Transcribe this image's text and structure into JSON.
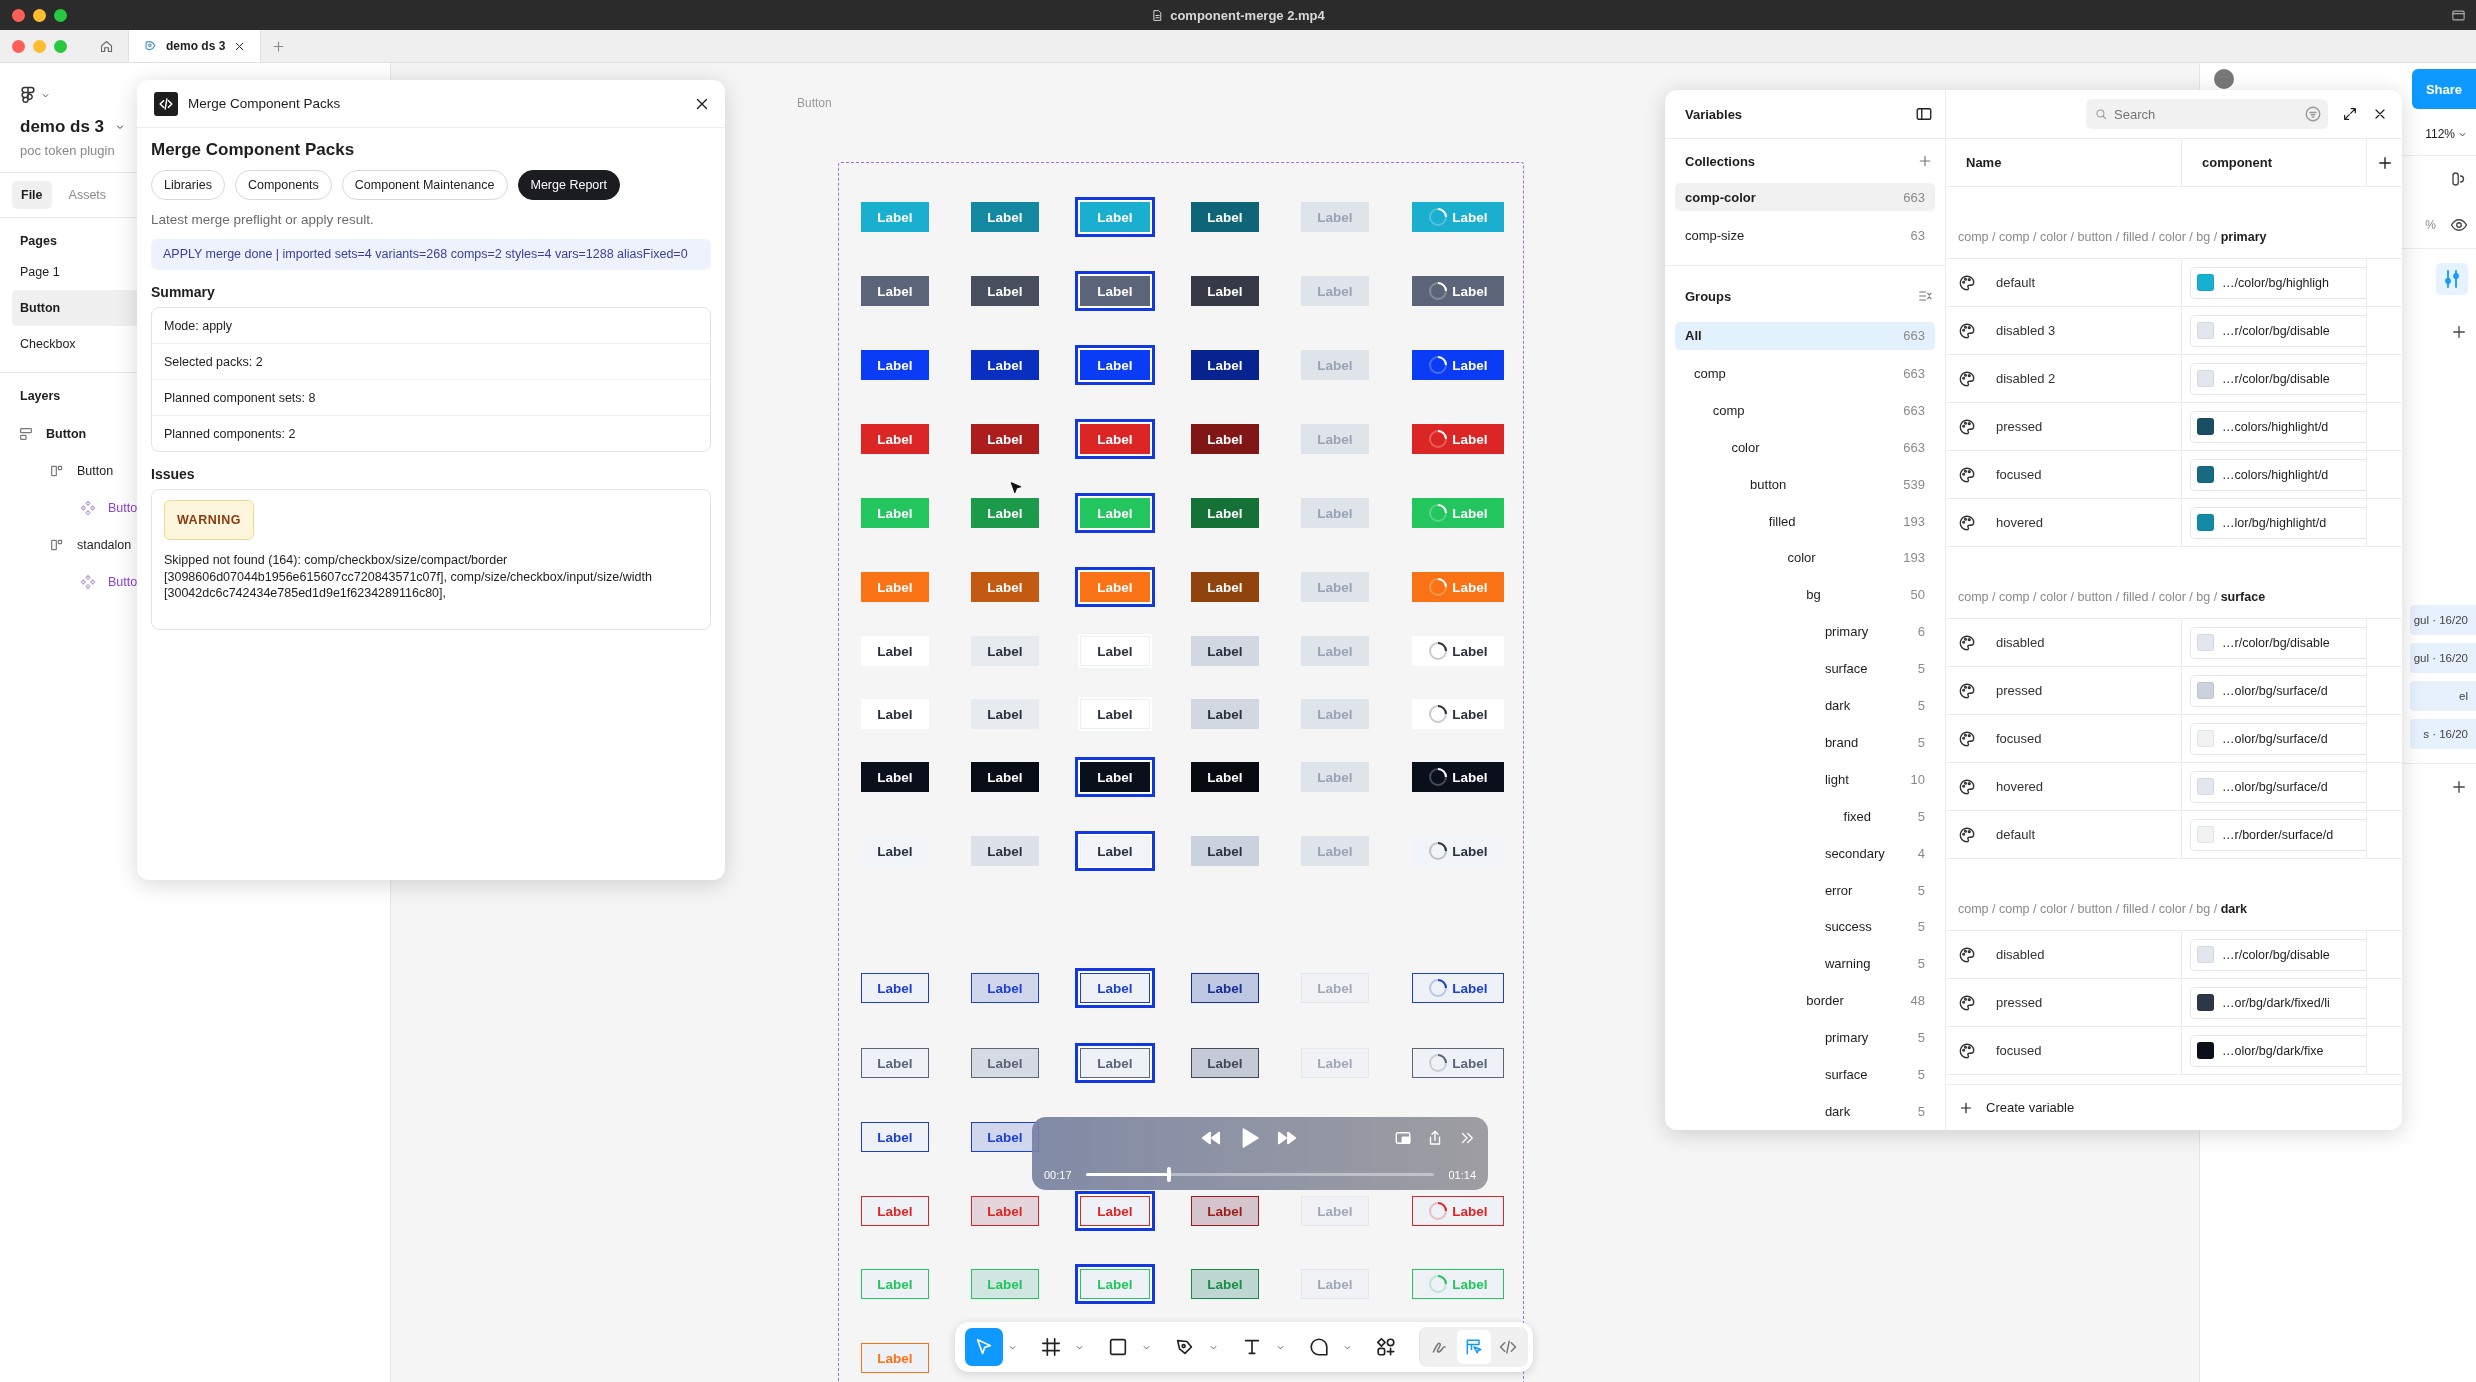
{
  "titlebar": {
    "title": "component-merge 2.mp4"
  },
  "tabbar": {
    "tabs": [
      {
        "label": "demo ds 3",
        "selected": true
      }
    ]
  },
  "sidebar": {
    "file_name": "demo ds 3",
    "subtitle": "poc token plugin",
    "tabs": [
      {
        "label": "File",
        "selected": true
      },
      {
        "label": "Assets",
        "selected": false
      }
    ],
    "pages_title": "Pages",
    "pages": [
      {
        "label": "Page 1",
        "selected": false
      },
      {
        "label": "Button",
        "selected": true
      },
      {
        "label": "Checkbox",
        "selected": false
      }
    ],
    "layers_title": "Layers",
    "layers": [
      {
        "label": "Button",
        "kind": "frame",
        "children": [
          {
            "label": "Button",
            "kind": "set",
            "children": [
              {
                "label": "Butto",
                "kind": "component"
              }
            ]
          },
          {
            "label": "standalon",
            "kind": "set",
            "children": [
              {
                "label": "Butto",
                "kind": "component"
              }
            ]
          }
        ]
      }
    ]
  },
  "canvas": {
    "frame_label": "Button",
    "rows": [
      {
        "kind": "filled",
        "color": "#1aaecf",
        "cells": [
          {
            "kind": "default",
            "label": "Label"
          },
          {
            "kind": "hover",
            "label": "Label"
          },
          {
            "kind": "focused",
            "label": "Label"
          },
          {
            "kind": "pressed",
            "label": "Label"
          },
          {
            "kind": "disabled",
            "label": "Label"
          },
          {
            "kind": "loading",
            "label": "Label"
          }
        ]
      },
      {
        "kind": "filled",
        "color": "#5b6478",
        "cells": [
          {
            "kind": "default",
            "label": "Label"
          },
          {
            "kind": "hover",
            "label": "Label"
          },
          {
            "kind": "focused",
            "label": "Label"
          },
          {
            "kind": "pressed",
            "label": "Label"
          },
          {
            "kind": "disabled",
            "label": "Label"
          },
          {
            "kind": "loading",
            "label": "Label"
          }
        ]
      },
      {
        "kind": "filled",
        "color": "#0a3cf5",
        "cells": [
          {
            "kind": "default",
            "label": "Label"
          },
          {
            "kind": "hover",
            "label": "Label"
          },
          {
            "kind": "focused",
            "label": "Label"
          },
          {
            "kind": "pressed",
            "label": "Label"
          },
          {
            "kind": "disabled",
            "label": "Label"
          },
          {
            "kind": "loading",
            "label": "Label"
          }
        ]
      },
      {
        "kind": "filled",
        "color": "#dc2626",
        "cells": [
          {
            "kind": "default",
            "label": "Label"
          },
          {
            "kind": "hover",
            "label": "Label"
          },
          {
            "kind": "focused",
            "label": "Label"
          },
          {
            "kind": "pressed",
            "label": "Label"
          },
          {
            "kind": "disabled",
            "label": "Label"
          },
          {
            "kind": "loading",
            "label": "Label"
          }
        ]
      },
      {
        "kind": "filled",
        "color": "#22c55e",
        "cells": [
          {
            "kind": "default",
            "label": "Label"
          },
          {
            "kind": "hover",
            "label": "Label"
          },
          {
            "kind": "focused",
            "label": "Label"
          },
          {
            "kind": "pressed",
            "label": "Label"
          },
          {
            "kind": "disabled",
            "label": "Label"
          },
          {
            "kind": "loading",
            "label": "Label"
          }
        ]
      },
      {
        "kind": "filled",
        "color": "#f97316",
        "cells": [
          {
            "kind": "default",
            "label": "Label"
          },
          {
            "kind": "hover",
            "label": "Label"
          },
          {
            "kind": "focused",
            "label": "Label"
          },
          {
            "kind": "pressed",
            "label": "Label"
          },
          {
            "kind": "disabled",
            "label": "Label"
          },
          {
            "kind": "loading",
            "label": "Label"
          }
        ]
      },
      {
        "kind": "filled",
        "color": "#ffffff",
        "cells": [
          {
            "kind": "default",
            "label": "Label"
          },
          {
            "kind": "hover",
            "label": "Label"
          },
          {
            "kind": "focused",
            "label": "Label"
          },
          {
            "kind": "pressed",
            "label": "Label"
          },
          {
            "kind": "disabled",
            "label": "Label"
          },
          {
            "kind": "loading",
            "label": "Label"
          }
        ]
      },
      {
        "kind": "filled",
        "color": "#ffffff",
        "cells": [
          {
            "kind": "default",
            "label": "Label"
          },
          {
            "kind": "hover",
            "label": "Label"
          },
          {
            "kind": "focused",
            "label": "Label"
          },
          {
            "kind": "pressed",
            "label": "Label"
          },
          {
            "kind": "disabled",
            "label": "Label"
          },
          {
            "kind": "loading",
            "label": "Label"
          }
        ]
      },
      {
        "kind": "filled",
        "color": "#0a0f1c",
        "cells": [
          {
            "kind": "default",
            "label": "Label"
          },
          {
            "kind": "hover",
            "label": "Label"
          },
          {
            "kind": "focused",
            "label": "Label"
          },
          {
            "kind": "pressed",
            "label": "Label"
          },
          {
            "kind": "disabled",
            "label": "Label"
          },
          {
            "kind": "loading",
            "label": "Label"
          }
        ]
      },
      {
        "kind": "filled",
        "color": "#f1f4f8",
        "cells": [
          {
            "kind": "default",
            "label": "Label"
          },
          {
            "kind": "hover",
            "label": "Label"
          },
          {
            "kind": "focused",
            "label": "Label"
          },
          {
            "kind": "pressed",
            "label": "Label"
          },
          {
            "kind": "disabled",
            "label": "Label"
          },
          {
            "kind": "loading",
            "label": "Label"
          }
        ]
      },
      {
        "kind": "outline",
        "color": "#1d3fd1",
        "cells": [
          {
            "kind": "default",
            "label": "Label"
          },
          {
            "kind": "hover",
            "label": "Label"
          },
          {
            "kind": "focused",
            "label": "Label"
          },
          {
            "kind": "pressed",
            "label": "Label"
          },
          {
            "kind": "disabled",
            "label": "Label"
          },
          {
            "kind": "loading",
            "label": "Label"
          }
        ]
      },
      {
        "kind": "outline",
        "color": "#5b6478",
        "cells": [
          {
            "kind": "default",
            "label": "Label"
          },
          {
            "kind": "hover",
            "label": "Label"
          },
          {
            "kind": "focused",
            "label": "Label"
          },
          {
            "kind": "pressed",
            "label": "Label"
          },
          {
            "kind": "disabled",
            "label": "Label"
          },
          {
            "kind": "loading",
            "label": "Label"
          }
        ]
      },
      {
        "kind": "outline",
        "color": "#1d3fd1",
        "cells": [
          {
            "kind": "default",
            "label": "Label"
          },
          {
            "kind": "hover",
            "label": "Label"
          }
        ]
      },
      {
        "kind": "outline",
        "color": "#dc2626",
        "cells": [
          {
            "kind": "default",
            "label": "Label"
          },
          {
            "kind": "hover",
            "label": "Label"
          },
          {
            "kind": "focused",
            "label": "Label"
          },
          {
            "kind": "pressed",
            "label": "Label"
          },
          {
            "kind": "disabled",
            "label": "Label"
          },
          {
            "kind": "loading",
            "label": "Label"
          }
        ]
      },
      {
        "kind": "outline",
        "color": "#22c55e",
        "cells": [
          {
            "kind": "default",
            "label": "Label"
          },
          {
            "kind": "hover",
            "label": "Label"
          },
          {
            "kind": "focused",
            "label": "Label"
          },
          {
            "kind": "pressed",
            "label": "Label"
          },
          {
            "kind": "disabled",
            "label": "Label"
          },
          {
            "kind": "loading",
            "label": "Label"
          }
        ]
      },
      {
        "kind": "outline",
        "color": "#f97316",
        "cells": [
          {
            "kind": "default",
            "label": "Label"
          }
        ]
      }
    ]
  },
  "plugin": {
    "title": "Merge Component Packs",
    "heading": "Merge Component Packs",
    "tabs": [
      {
        "label": "Libraries",
        "selected": false
      },
      {
        "label": "Components",
        "selected": false
      },
      {
        "label": "Component Maintenance",
        "selected": false
      },
      {
        "label": "Merge Report",
        "selected": true
      }
    ],
    "description": "Latest merge preflight or apply result.",
    "result": "APPLY merge done | imported sets=4 variants=268 comps=2 styles=4 vars=1288 aliasFixed=0",
    "summary_title": "Summary",
    "summary": [
      "Mode: apply",
      "Selected packs: 2",
      "Planned component sets: 8",
      "Planned components: 2"
    ],
    "issues_title": "Issues",
    "issues": [
      {
        "kind": "warning",
        "severity": "WARNING",
        "text": "Skipped not found (164): comp/checkbox/size/compact/border [3098606d07044b1956e615607cc720843571c07f], comp/size/checkbox/input/size/width [30042dc6c742434e785ed1d9e1f6234289116c80],"
      }
    ]
  },
  "variables": {
    "title": "Variables",
    "collections_title": "Collections",
    "collections": [
      {
        "name": "comp-color",
        "count": "663",
        "selected": true
      },
      {
        "name": "comp-size",
        "count": "63",
        "selected": false
      }
    ],
    "groups_title": "Groups",
    "all": {
      "name": "All",
      "count": "663",
      "selected": true
    },
    "groups": [
      {
        "name": "comp",
        "count": "663",
        "selected": false,
        "children": [
          {
            "name": "comp",
            "count": "663",
            "selected": false,
            "children": [
              {
                "name": "color",
                "count": "663",
                "selected": false,
                "children": [
                  {
                    "name": "button",
                    "count": "539",
                    "selected": false,
                    "children": [
                      {
                        "name": "filled",
                        "count": "193",
                        "selected": false,
                        "children": [
                          {
                            "name": "color",
                            "count": "193",
                            "selected": false,
                            "children": [
                              {
                                "name": "bg",
                                "count": "50",
                                "selected": false,
                                "children": [
                                  {
                                    "name": "primary",
                                    "count": "6",
                                    "selected": false
                                  },
                                  {
                                    "name": "surface",
                                    "count": "5",
                                    "selected": false
                                  },
                                  {
                                    "name": "dark",
                                    "count": "5",
                                    "selected": false
                                  },
                                  {
                                    "name": "brand",
                                    "count": "5",
                                    "selected": false
                                  },
                                  {
                                    "name": "light",
                                    "count": "10",
                                    "selected": false,
                                    "children": [
                                      {
                                        "name": "fixed",
                                        "count": "5",
                                        "selected": false
                                      }
                                    ]
                                  },
                                  {
                                    "name": "secondary",
                                    "count": "4",
                                    "selected": false
                                  },
                                  {
                                    "name": "error",
                                    "count": "5",
                                    "selected": false
                                  },
                                  {
                                    "name": "success",
                                    "count": "5",
                                    "selected": false
                                  },
                                  {
                                    "name": "warning",
                                    "count": "5",
                                    "selected": false
                                  }
                                ]
                              },
                              {
                                "name": "border",
                                "count": "48",
                                "selected": false,
                                "children": [
                                  {
                                    "name": "primary",
                                    "count": "5",
                                    "selected": false
                                  },
                                  {
                                    "name": "surface",
                                    "count": "5",
                                    "selected": false
                                  },
                                  {
                                    "name": "dark",
                                    "count": "5",
                                    "selected": false
                                  }
                                ]
                              }
                            ]
                          }
                        ]
                      }
                    ]
                  }
                ]
              }
            ]
          }
        ]
      }
    ],
    "search": {
      "placeholder": "Search"
    },
    "columns": [
      "Name",
      "component"
    ],
    "sections": [
      {
        "path": "comp / comp / color / button / filled / color / bg / **primary**",
        "rows": [
          {
            "name": "default",
            "color": "#17b0d1",
            "value": "…/color/bg/highligh"
          },
          {
            "name": "disabled 3",
            "color": "#e2e6ee",
            "value": "…r/color/bg/disable"
          },
          {
            "name": "disabled 2",
            "color": "#e2e6ee",
            "value": "…r/color/bg/disable"
          },
          {
            "name": "pressed",
            "color": "#1a4f63",
            "value": "…colors/highlight/d"
          },
          {
            "name": "focused",
            "color": "#176a80",
            "value": "…colors/highlight/d"
          },
          {
            "name": "hovered",
            "color": "#138ba6",
            "value": "…lor/bg/highlight/d"
          }
        ]
      },
      {
        "path": "comp / comp / color / button / filled / color / bg / **surface**",
        "rows": [
          {
            "name": "disabled",
            "color": "#e2e6ee",
            "value": "…r/color/bg/disable"
          },
          {
            "name": "pressed",
            "color": "#cbd2dc",
            "value": "…olor/bg/surface/d"
          },
          {
            "name": "focused",
            "color": "#f1f2f4",
            "value": "…olor/bg/surface/d"
          },
          {
            "name": "hovered",
            "color": "#e2e6ee",
            "value": "…olor/bg/surface/d"
          },
          {
            "name": "default",
            "color": "#f1f2f4",
            "value": "…r/border/surface/d"
          }
        ]
      },
      {
        "path": "comp / comp / color / button / filled / color / bg / **dark**",
        "rows": [
          {
            "name": "disabled",
            "color": "#e2e6ee",
            "value": "…r/color/bg/disable"
          },
          {
            "name": "pressed",
            "color": "#2d3748",
            "value": "…or/bg/dark/fixed/li"
          },
          {
            "name": "focused",
            "color": "#0b0f1a",
            "value": "…olor/bg/dark/fixe"
          }
        ]
      }
    ],
    "create_label": "Create variable"
  },
  "right_panel": {
    "share": "Share",
    "zoom": "112%",
    "unit": "%",
    "rows": [
      "gul · 16/20",
      "gul · 16/20",
      "el",
      "s · 16/20"
    ]
  },
  "video": {
    "elapsed": "00:17",
    "total": "01:14",
    "level": 0.24
  },
  "toolbar": {
    "tools": [
      {
        "kind": "move",
        "selected": true
      },
      {
        "kind": "frame",
        "selected": false
      },
      {
        "kind": "rectangle",
        "selected": false
      },
      {
        "kind": "pen",
        "selected": false
      },
      {
        "kind": "text",
        "selected": false
      },
      {
        "kind": "comment",
        "selected": false
      },
      {
        "kind": "actions",
        "selected": false
      }
    ],
    "modes": [
      {
        "kind": "draw",
        "selected": false
      },
      {
        "kind": "design",
        "selected": true
      },
      {
        "kind": "dev",
        "selected": false
      }
    ]
  }
}
